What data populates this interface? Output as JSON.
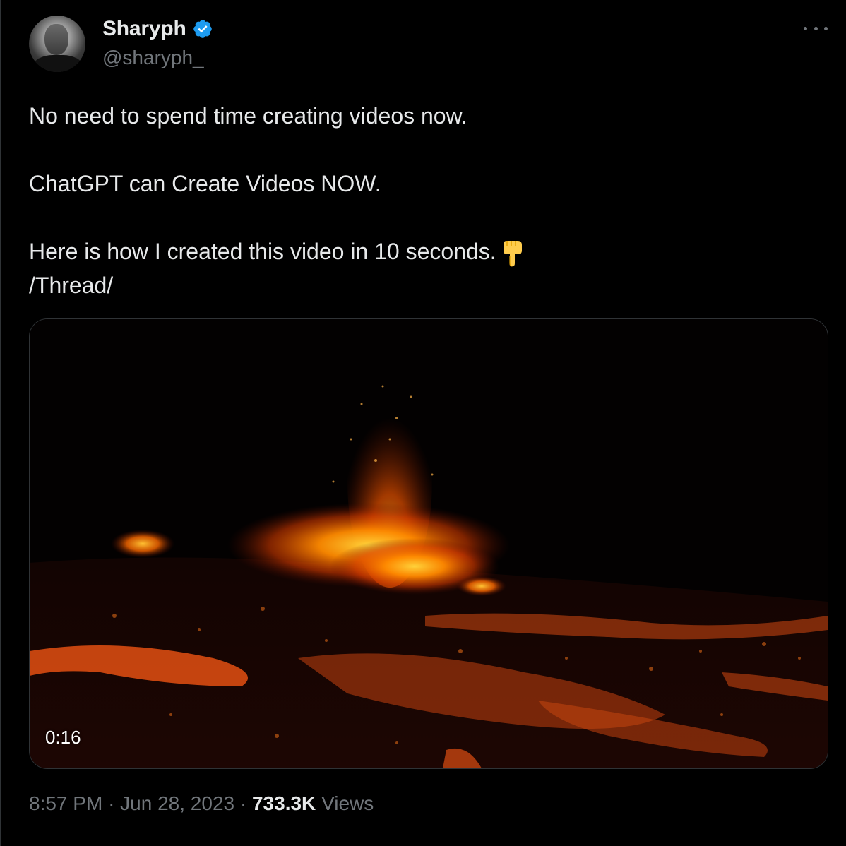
{
  "author": {
    "display_name": "Sharyph",
    "handle": "@sharyph_",
    "verified": true,
    "verified_color": "#1d9bf0"
  },
  "tweet": {
    "lines": [
      "No need to spend time creating videos now.",
      "ChatGPT can Create Videos NOW.",
      "Here is how I created this video in 10 seconds.",
      "/Thread/"
    ],
    "emoji": "backhand-index-pointing-down"
  },
  "media": {
    "type": "video",
    "duration": "0:16"
  },
  "meta": {
    "time": "8:57 PM",
    "separator": "·",
    "date": "Jun 28, 2023",
    "views_count": "733.3K",
    "views_label": "Views"
  },
  "icons": {
    "more": "more-horizontal-icon",
    "verified": "verified-badge-icon"
  },
  "colors": {
    "background": "#000000",
    "text_primary": "#e7e9ea",
    "text_secondary": "#71767b",
    "border": "#2f3336",
    "lava": "#ff6a00"
  }
}
